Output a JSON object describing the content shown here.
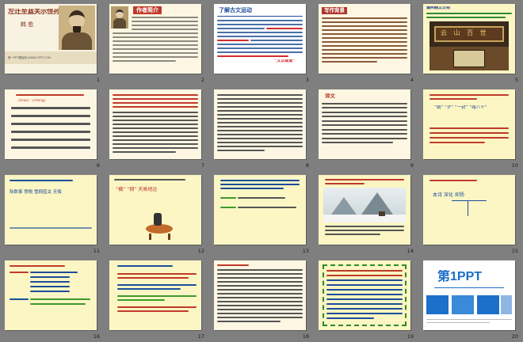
{
  "slides": [
    {
      "num": "1",
      "title": "左迁至蓝关示侄孙湘",
      "author": "韩 愈",
      "footer": "第一PPT模板网-WWW.1PPT.COM"
    },
    {
      "num": "2",
      "title": "作者简介"
    },
    {
      "num": "3",
      "title": "了解古文运动",
      "highlight": "“文以载道”"
    },
    {
      "num": "4",
      "title": "写作背景",
      "badge": "写作背景"
    },
    {
      "num": "5",
      "caption": "潮州韩文公祠",
      "plaque": "云 山 百 世"
    },
    {
      "num": "6",
      "pinyin": "（zhāo）（cháng）"
    },
    {
      "num": "7"
    },
    {
      "num": "8"
    },
    {
      "num": "9",
      "title": "译文"
    },
    {
      "num": "10",
      "words": "“朝” “夕” “一封” “路八千”"
    },
    {
      "num": "11",
      "words": "除数事  愤慨  雪拥蓝关  无悔"
    },
    {
      "num": "12",
      "words": "“横” “拥” 天高地远"
    },
    {
      "num": "13"
    },
    {
      "num": "14"
    },
    {
      "num": "15",
      "words": "本诗  深化  抑扬"
    },
    {
      "num": "16"
    },
    {
      "num": "17"
    },
    {
      "num": "18"
    },
    {
      "num": "19"
    },
    {
      "num": "20",
      "logo": "第1PPT"
    }
  ],
  "colors": {
    "bg": "#7f7f7f",
    "cream": "#fdf6e2",
    "yellow": "#fbf6c4",
    "brown": "#7a3212",
    "red": "#c0392b",
    "navy": "#1d4d9a",
    "green": "#3c9a2b"
  }
}
